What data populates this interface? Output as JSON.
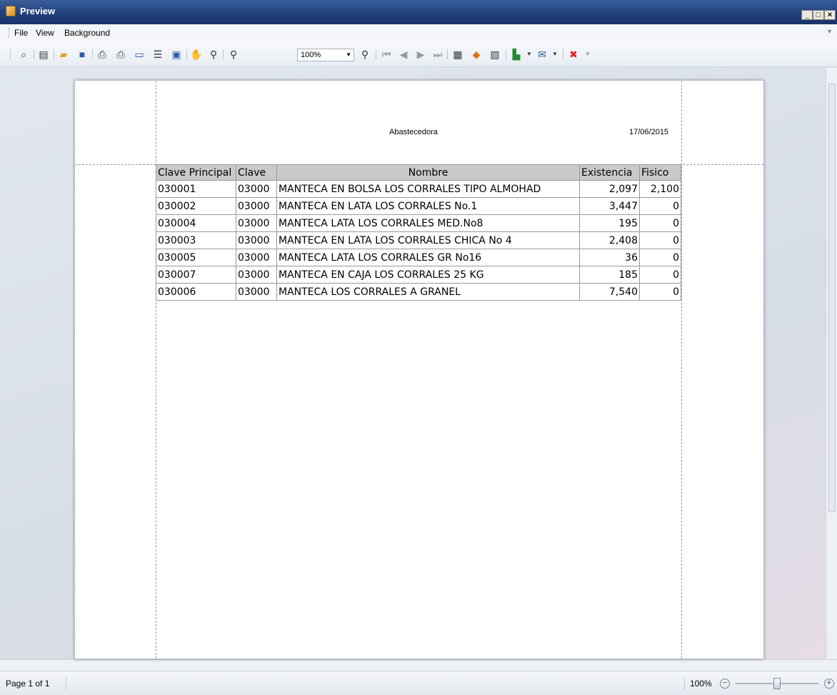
{
  "window": {
    "title": "Preview"
  },
  "menu": {
    "file": "File",
    "view": "View",
    "background": "Background"
  },
  "toolbar": {
    "zoom_value": "100%",
    "icons": [
      "find-icon",
      "parameters-icon",
      "open-icon",
      "save-icon",
      "print-icon",
      "quick-print-icon",
      "page-setup-icon",
      "header-footer-icon",
      "scale-icon",
      "hand-tool-icon",
      "magnifier-icon",
      "zoom-out-icon",
      "zoom-in-icon",
      "first-page-icon",
      "previous-page-icon",
      "next-page-icon",
      "last-page-icon",
      "multiple-pages-icon",
      "color-icon",
      "watermark-icon",
      "export-icon",
      "email-icon",
      "close-preview-icon"
    ]
  },
  "report": {
    "company": "Abastecedora",
    "date": "17/06/2015",
    "columns": [
      "Clave Principal",
      "Clave",
      "Nombre",
      "Existencia",
      "Fisico"
    ],
    "rows": [
      [
        "030001",
        "03000",
        "MANTECA EN BOLSA LOS CORRALES TIPO ALMOHAD",
        "2,097",
        "2,100"
      ],
      [
        "030002",
        "03000",
        "MANTECA EN LATA LOS CORRALES No.1",
        "3,447",
        "0"
      ],
      [
        "030004",
        "03000",
        "MANTECA LATA LOS CORRALES MED.No8",
        "195",
        "0"
      ],
      [
        "030003",
        "03000",
        "MANTECA EN LATA LOS CORRALES CHICA No 4",
        "2,408",
        "0"
      ],
      [
        "030005",
        "03000",
        "MANTECA LATA LOS CORRALES GR No16",
        "36",
        "0"
      ],
      [
        "030007",
        "03000",
        "MANTECA EN CAJA LOS CORRALES 25 KG",
        "185",
        "0"
      ],
      [
        "030006",
        "03000",
        "MANTECA LOS CORRALES A GRANEL",
        "7,540",
        "0"
      ]
    ]
  },
  "status": {
    "page": "Page 1 of 1",
    "zoom": "100%"
  }
}
